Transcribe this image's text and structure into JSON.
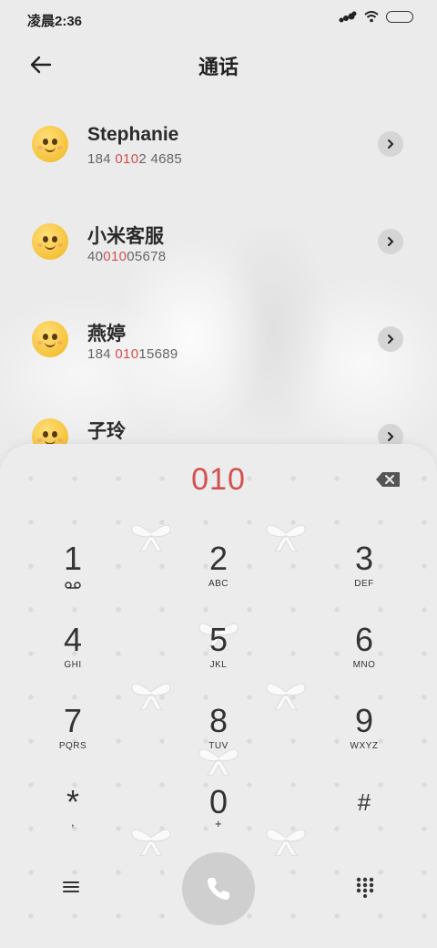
{
  "status_bar": {
    "time": "凌晨2:36"
  },
  "header": {
    "title": "通话"
  },
  "contacts": [
    {
      "name": "Stephanie",
      "number_pre": "184 ",
      "number_hl": "010",
      "number_post": "2 4685"
    },
    {
      "name": "小米客服",
      "number_pre": "40",
      "number_hl": "010",
      "number_post": "05678"
    },
    {
      "name": "燕婷",
      "number_pre": "184 ",
      "number_hl": "010",
      "number_post": "15689"
    },
    {
      "name": "子玲",
      "number_pre": "",
      "number_hl": "",
      "number_post": ""
    }
  ],
  "dialer": {
    "input": "010",
    "keys": [
      {
        "digit": "1",
        "letters": ""
      },
      {
        "digit": "2",
        "letters": "ABC"
      },
      {
        "digit": "3",
        "letters": "DEF"
      },
      {
        "digit": "4",
        "letters": "GHI"
      },
      {
        "digit": "5",
        "letters": "JKL"
      },
      {
        "digit": "6",
        "letters": "MNO"
      },
      {
        "digit": "7",
        "letters": "PQRS"
      },
      {
        "digit": "8",
        "letters": "TUV"
      },
      {
        "digit": "9",
        "letters": "WXYZ"
      },
      {
        "digit": "*",
        "letters": ","
      },
      {
        "digit": "0",
        "letters": "+"
      },
      {
        "digit": "#",
        "letters": ""
      }
    ]
  },
  "colors": {
    "accent": "#d2504f",
    "call_button": "#cfcfcf"
  },
  "icons": {
    "back": "arrow-left-icon",
    "detail": "chevron-right-icon",
    "delete": "backspace-icon",
    "voicemail": "voicemail-icon",
    "menu": "menu-icon",
    "call": "phone-icon",
    "keypad": "keypad-icon"
  }
}
